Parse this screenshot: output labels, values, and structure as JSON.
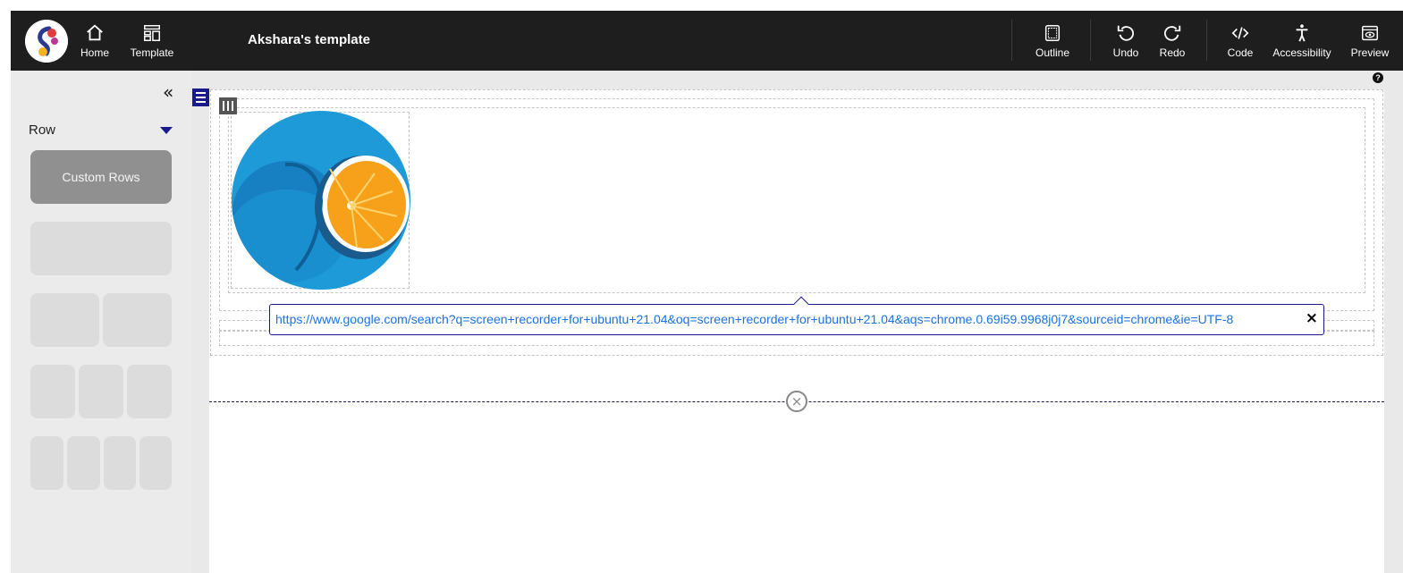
{
  "topbar": {
    "title": "Akshara's template",
    "nav": {
      "home": "Home",
      "template": "Template",
      "outline": "Outline",
      "undo": "Undo",
      "redo": "Redo",
      "code": "Code",
      "accessibility": "Accessibility",
      "preview": "Preview"
    }
  },
  "sidebar": {
    "collapse_icon": "«",
    "section_label": "Row",
    "custom_rows_label": "Custom Rows",
    "layouts": [
      "1-column",
      "2-column",
      "3-column",
      "4-column"
    ]
  },
  "canvas": {
    "help_icon": "?",
    "image_icon": "blue-orange-image",
    "link": {
      "url": "https://www.google.com/search?q=screen+recorder+for+ubuntu+21.04&oq=screen+recorder+for+ubuntu+21.04&aqs=chrome.0.69i59.9968j0j7&sourceid=chrome&ie=UTF-8",
      "close": "×"
    },
    "divider_close": "×"
  },
  "colors": {
    "topbar": "#1e1e1e",
    "accent": "#1a1a8c",
    "link": "#1a73e8",
    "sidebar": "#ebebeb"
  }
}
